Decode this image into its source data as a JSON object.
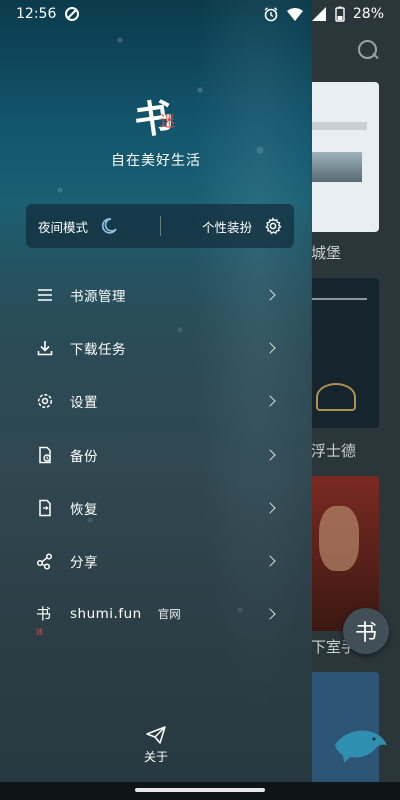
{
  "status_bar": {
    "time": "12:56",
    "battery": "28%"
  },
  "drawer": {
    "logo_char": "书",
    "logo_small": "迷",
    "slogan": "自在美好生活",
    "night_mode_label": "夜间模式",
    "theme_label": "个性装扮",
    "menu": [
      {
        "label": "书源管理",
        "icon": "list-icon"
      },
      {
        "label": "下载任务",
        "icon": "download-icon"
      },
      {
        "label": "设置",
        "icon": "gear-icon"
      },
      {
        "label": "备份",
        "icon": "backup-icon"
      },
      {
        "label": "恢复",
        "icon": "restore-icon"
      },
      {
        "label": "分享",
        "icon": "share-icon"
      },
      {
        "label": "shumi.fun",
        "sub": "官网",
        "icon": "logo-icon"
      }
    ],
    "about_label": "关于"
  },
  "background": {
    "book_labels": [
      "城堡",
      "浮士德",
      "下室手记"
    ],
    "fab_char": "书"
  }
}
